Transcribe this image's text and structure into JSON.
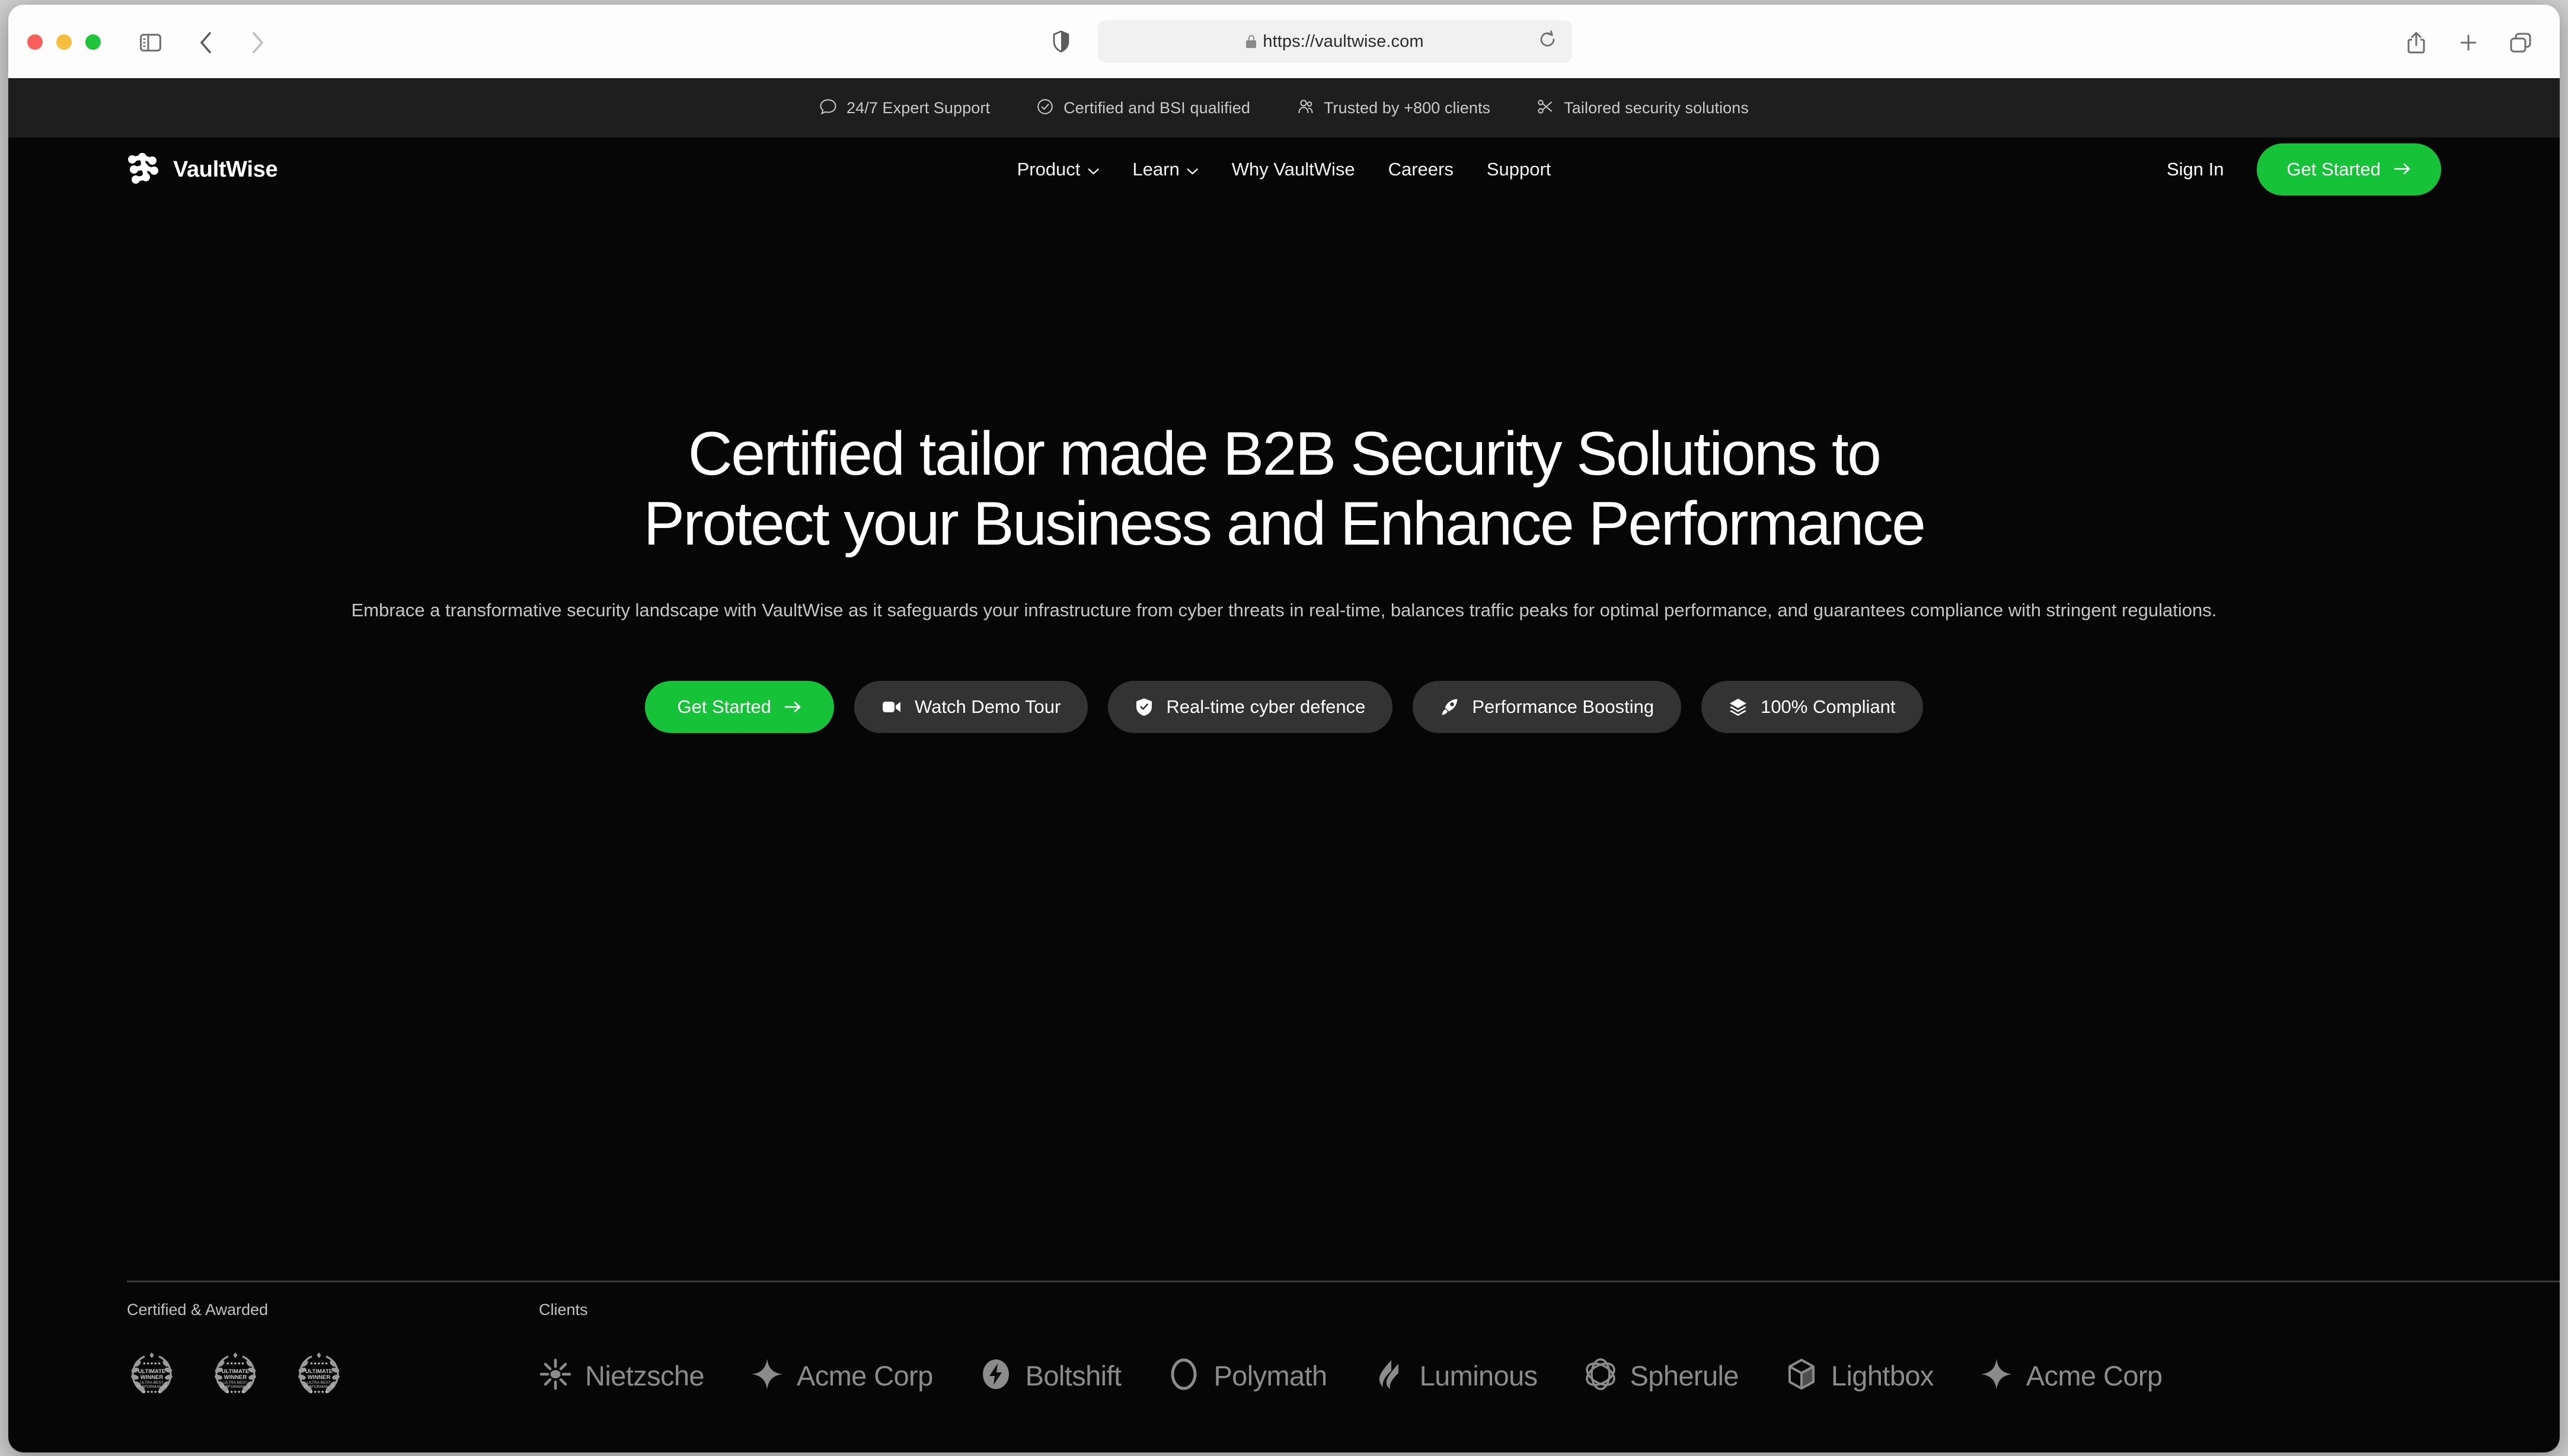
{
  "browser": {
    "url": "https://vaultwise.com",
    "traffic_lights": [
      "close-red",
      "minimize-yellow",
      "maximize-green"
    ],
    "icons": {
      "sidebar": "sidebar-toggle-icon",
      "back": "back-arrow-icon",
      "forward": "forward-arrow-icon",
      "shield": "privacy-shield-icon",
      "lock": "lock-icon",
      "reload": "reload-icon",
      "share": "share-icon",
      "new_tab": "plus-icon",
      "tabs": "tab-overview-icon"
    }
  },
  "announcement": {
    "items": [
      {
        "icon": "chat-bubble-icon",
        "label": "24/7 Expert Support"
      },
      {
        "icon": "check-circle-icon",
        "label": "Certified and BSI qualified"
      },
      {
        "icon": "users-icon",
        "label": "Trusted by +800 clients"
      },
      {
        "icon": "scissors-icon",
        "label": "Tailored security solutions"
      }
    ]
  },
  "header": {
    "logo_text": "VaultWise",
    "logo_icon": "vaultwise-network-logo",
    "nav": [
      {
        "label": "Product",
        "has_dropdown": true
      },
      {
        "label": "Learn",
        "has_dropdown": true
      },
      {
        "label": "Why VaultWise",
        "has_dropdown": false
      },
      {
        "label": "Careers",
        "has_dropdown": false
      },
      {
        "label": "Support",
        "has_dropdown": false
      }
    ],
    "sign_in": "Sign In",
    "cta": "Get Started"
  },
  "hero": {
    "headline_line1": "Certified tailor made B2B Security Solutions to",
    "headline_line2": "Protect your Business and Enhance Performance",
    "subhead": "Embrace a transformative security landscape with VaultWise as it safeguards your infrastructure from cyber threats in real-time, balances traffic peaks for optimal performance, and guarantees compliance with stringent regulations.",
    "pills": [
      {
        "label": "Get Started",
        "icon": "arrow-right-icon",
        "style": "primary"
      },
      {
        "label": "Watch Demo Tour",
        "icon": "video-camera-icon",
        "style": "secondary"
      },
      {
        "label": "Real-time cyber defence",
        "icon": "shield-check-icon",
        "style": "secondary"
      },
      {
        "label": "Performance Boosting",
        "icon": "rocket-icon",
        "style": "secondary"
      },
      {
        "label": "100% Compliant",
        "icon": "layers-icon",
        "style": "secondary"
      }
    ]
  },
  "band": {
    "awards_label": "Certified & Awarded",
    "clients_label": "Clients",
    "awards": [
      {
        "icon": "laurel-wreath-badge",
        "title": "ULTIMATE WINNER",
        "subtitle_line1": "ULTRA BEST",
        "subtitle_line2": "PERFORMANCE"
      },
      {
        "icon": "laurel-wreath-badge",
        "title": "ULTIMATE WINNER",
        "subtitle_line1": "ULTRA BEST",
        "subtitle_line2": "PERFORMANCE"
      },
      {
        "icon": "laurel-wreath-badge",
        "title": "ULTIMATE WINNER",
        "subtitle_line1": "ULTRA BEST",
        "subtitle_line2": "PERFORMANCE"
      }
    ],
    "clients": [
      {
        "name": "Nietzsche",
        "icon": "sunburst-icon"
      },
      {
        "name": "Acme Corp",
        "icon": "four-point-star-icon"
      },
      {
        "name": "Boltshift",
        "icon": "lightning-circle-icon"
      },
      {
        "name": "Polymath",
        "icon": "ring-icon"
      },
      {
        "name": "Luminous",
        "icon": "flame-waves-icon"
      },
      {
        "name": "Spherule",
        "icon": "ellipse-orbit-icon"
      },
      {
        "name": "Lightbox",
        "icon": "cube-icon"
      },
      {
        "name": "Acme Corp",
        "icon": "four-point-star-icon"
      }
    ]
  },
  "colors": {
    "accent_green": "#16c338",
    "page_background": "#060606",
    "announce_background": "#1e1e1e",
    "pill_background": "#333333",
    "client_logo_gray": "#8b8b8b"
  }
}
